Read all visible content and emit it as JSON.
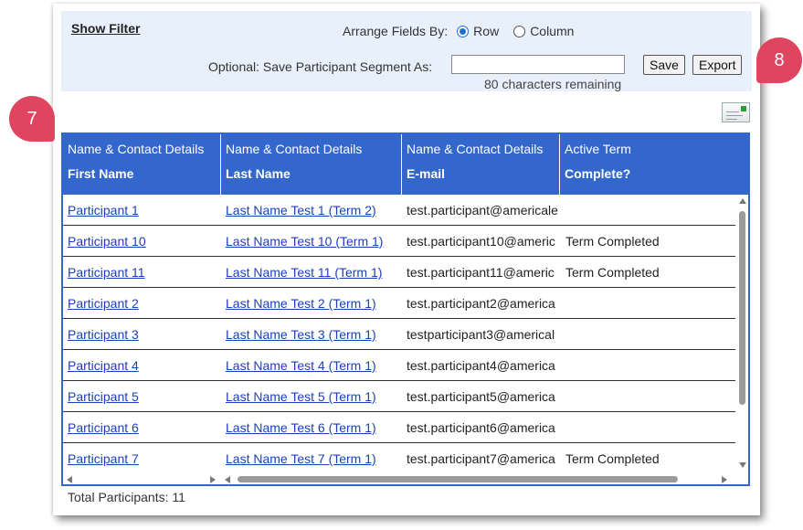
{
  "filter": {
    "show_filter_label": "Show Filter",
    "arrange_label": "Arrange Fields By:",
    "options": [
      "Row",
      "Column"
    ],
    "selected": "Row",
    "segment_label": "Optional: Save Participant Segment As:",
    "segment_value": "",
    "remaining": "80 characters remaining",
    "save_label": "Save",
    "export_label": "Export"
  },
  "callouts": {
    "a": "8",
    "b": "7"
  },
  "colors": {
    "header_blue": "#3367cc",
    "callout": "#e0455f",
    "filter_bg": "#e8f1fb",
    "link": "#1a3fbf"
  },
  "table": {
    "columns": [
      {
        "group": "Name & Contact Details",
        "field": "First Name"
      },
      {
        "group": "Name & Contact Details",
        "field": "Last Name"
      },
      {
        "group": "Name & Contact Details",
        "field": "E-mail"
      },
      {
        "group": "Active Term",
        "field": "Complete?"
      }
    ],
    "rows": [
      {
        "first": "Participant 1",
        "last": "Last Name Test 1 (Term 2)",
        "email": "test.participant@americale",
        "complete": ""
      },
      {
        "first": "Participant 10",
        "last": "Last Name Test 10 (Term 1)",
        "email": "test.participant10@americ",
        "complete": "Term Completed"
      },
      {
        "first": "Participant 11",
        "last": "Last Name Test 11 (Term 1)",
        "email": "test.participant11@americ",
        "complete": "Term Completed"
      },
      {
        "first": "Participant 2",
        "last": "Last Name Test 2 (Term 1)",
        "email": "test.participant2@america",
        "complete": ""
      },
      {
        "first": "Participant 3",
        "last": "Last Name Test 3 (Term 1)",
        "email": "testparticipant3@americal",
        "complete": ""
      },
      {
        "first": "Participant 4",
        "last": "Last Name Test 4 (Term 1)",
        "email": "test.participant4@america",
        "complete": ""
      },
      {
        "first": "Participant 5",
        "last": "Last Name Test 5 (Term 1)",
        "email": "test.participant5@america",
        "complete": ""
      },
      {
        "first": "Participant 6",
        "last": "Last Name Test 6 (Term 1)",
        "email": "test.participant6@america",
        "complete": ""
      },
      {
        "first": "Participant 7",
        "last": "Last Name Test 7 (Term 1)",
        "email": "test.participant7@america",
        "complete": "Term Completed"
      }
    ]
  },
  "footer": {
    "total": "Total Participants: 11"
  },
  "icons": {
    "export": "export-file-icon"
  }
}
